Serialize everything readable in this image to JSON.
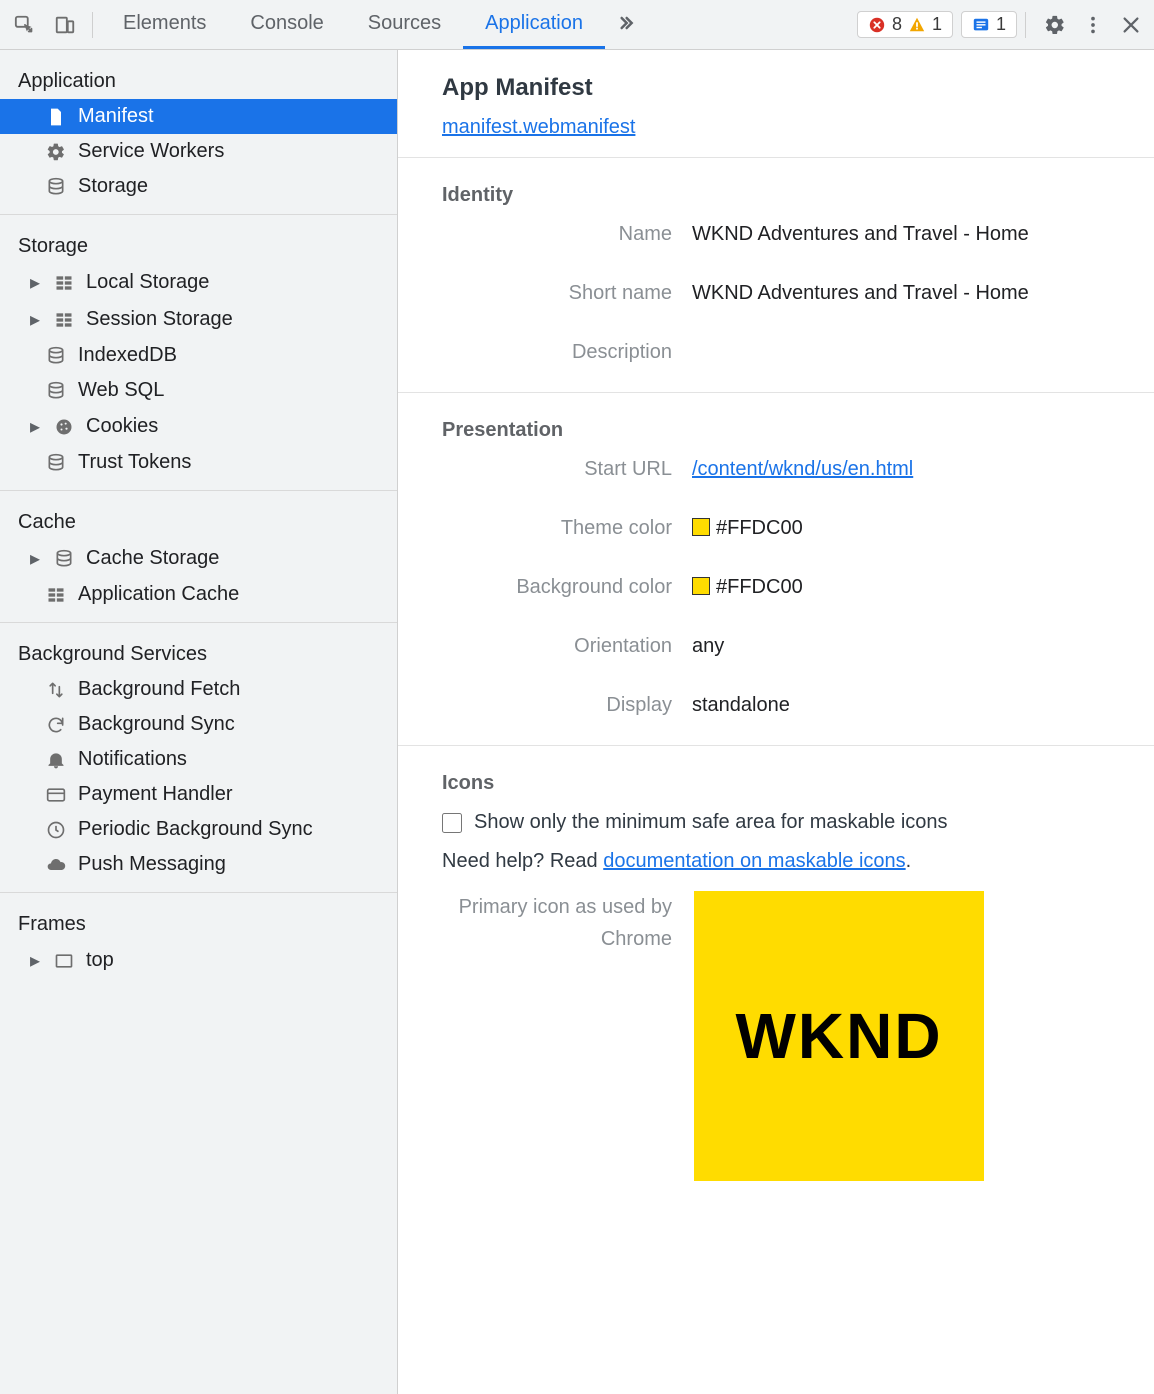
{
  "tabs": {
    "elements": "Elements",
    "console": "Console",
    "sources": "Sources",
    "application": "Application"
  },
  "badges": {
    "errors": "8",
    "warnings": "1",
    "info": "1"
  },
  "sidebar": {
    "application": {
      "heading": "Application",
      "manifest": "Manifest",
      "service_workers": "Service Workers",
      "storage": "Storage"
    },
    "storage": {
      "heading": "Storage",
      "local_storage": "Local Storage",
      "session_storage": "Session Storage",
      "indexeddb": "IndexedDB",
      "web_sql": "Web SQL",
      "cookies": "Cookies",
      "trust_tokens": "Trust Tokens"
    },
    "cache": {
      "heading": "Cache",
      "cache_storage": "Cache Storage",
      "application_cache": "Application Cache"
    },
    "bg": {
      "heading": "Background Services",
      "bg_fetch": "Background Fetch",
      "bg_sync": "Background Sync",
      "notifications": "Notifications",
      "payment": "Payment Handler",
      "periodic": "Periodic Background Sync",
      "push": "Push Messaging"
    },
    "frames": {
      "heading": "Frames",
      "top": "top"
    }
  },
  "main": {
    "title": "App Manifest",
    "manifest_link": "manifest.webmanifest",
    "identity": {
      "heading": "Identity",
      "name_label": "Name",
      "name_value": "WKND Adventures and Travel - Home",
      "short_name_label": "Short name",
      "short_name_value": "WKND Adventures and Travel - Home",
      "description_label": "Description",
      "description_value": ""
    },
    "presentation": {
      "heading": "Presentation",
      "start_url_label": "Start URL",
      "start_url_value": "/content/wknd/us/en.html",
      "theme_color_label": "Theme color",
      "theme_color_value": "#FFDC00",
      "bg_color_label": "Background color",
      "bg_color_value": "#FFDC00",
      "orientation_label": "Orientation",
      "orientation_value": "any",
      "display_label": "Display",
      "display_value": "standalone"
    },
    "icons": {
      "heading": "Icons",
      "checkbox_label": "Show only the minimum safe area for maskable icons",
      "help_prefix": "Need help? Read ",
      "help_link": "documentation on maskable icons",
      "help_suffix": ".",
      "caption": "Primary icon as used by Chrome",
      "icon_text": "WKND",
      "icon_bg": "#FFDC00"
    }
  }
}
